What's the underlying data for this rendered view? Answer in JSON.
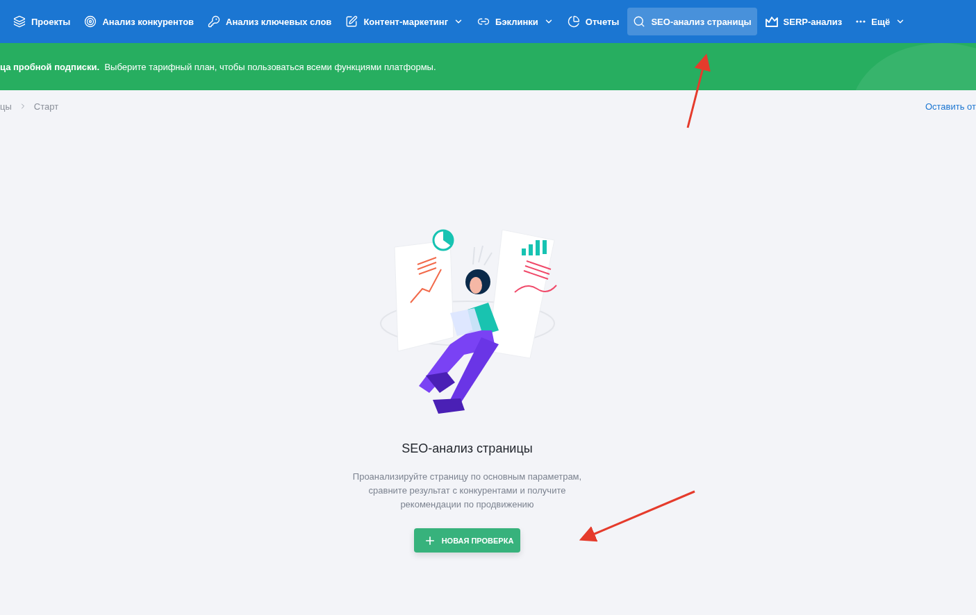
{
  "nav": {
    "items": [
      {
        "label": "Проекты",
        "selected": false,
        "dropdown": false
      },
      {
        "label": "Анализ конкурентов",
        "selected": false,
        "dropdown": false
      },
      {
        "label": "Анализ ключевых слов",
        "selected": false,
        "dropdown": false
      },
      {
        "label": "Контент-маркетинг",
        "selected": false,
        "dropdown": true
      },
      {
        "label": "Бэклинки",
        "selected": false,
        "dropdown": true
      },
      {
        "label": "Отчеты",
        "selected": false,
        "dropdown": false
      },
      {
        "label": "SEO-анализ страницы",
        "selected": true,
        "dropdown": false
      },
      {
        "label": "SERP-анализ",
        "selected": false,
        "dropdown": false
      },
      {
        "label": "Ещё",
        "selected": false,
        "dropdown": true
      }
    ]
  },
  "banner": {
    "text": "**ца пробной подписки.**  Выберите тарифный план, чтобы пользоваться всеми функциями платформы."
  },
  "breadcrumbs": [
    "цы",
    "Старт"
  ],
  "feedback_link": "Оставить от",
  "empty_state": {
    "title": "SEO-анализ страницы",
    "description": "Проанализируйте страницу по основным параметрам, сравните результат с конкурентами и получите рекомендации по продвижению",
    "button": "НОВАЯ ПРОВЕРКА"
  }
}
